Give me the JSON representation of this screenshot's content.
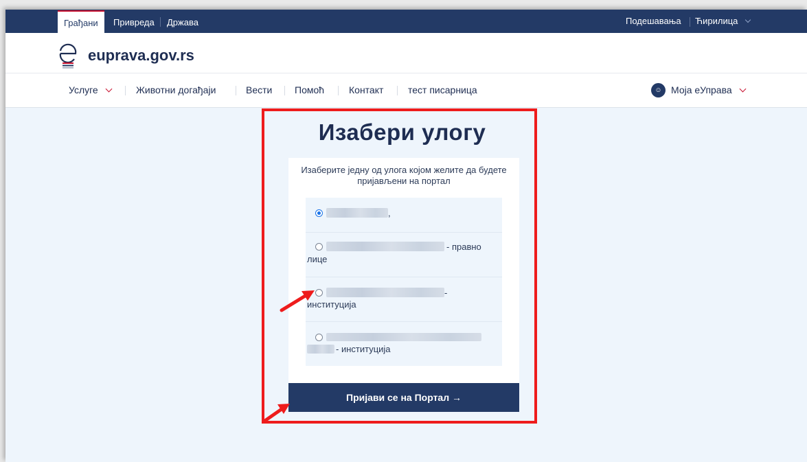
{
  "topbar": {
    "tabs": [
      {
        "label": "Грађани",
        "active": true
      },
      {
        "label": "Привреда",
        "active": false
      },
      {
        "label": "Држава",
        "active": false
      }
    ],
    "settings_label": "Подешавања",
    "language_label": "Ћирилица"
  },
  "header": {
    "logo_text": "euprava.gov.rs"
  },
  "nav": {
    "items": [
      {
        "label": "Услуге"
      },
      {
        "label": "Животни догађаји"
      },
      {
        "label": "Вести"
      },
      {
        "label": "Помоћ"
      },
      {
        "label": "Контакт"
      },
      {
        "label": "тест писарница"
      }
    ],
    "account_label": "Моја еУправа"
  },
  "main": {
    "title": "Изабери улогу",
    "instruction": "Изаберите једну од улога којом желите да будете пријављени на портал",
    "roles": [
      {
        "suffix": ",",
        "selected": true
      },
      {
        "suffix": "- правно лице",
        "line1_suffix": "- правно",
        "line2": "лице",
        "selected": false
      },
      {
        "suffix": "- институција",
        "line1_suffix": "-",
        "line2": "институција",
        "selected": false
      },
      {
        "suffix": "- институција",
        "line2": "- институција",
        "selected": false
      }
    ],
    "login_button": "Пријави се на Портал →"
  },
  "colors": {
    "primary": "#233a66",
    "accent_red": "#c8102e",
    "annotation_red": "#ee1c1c",
    "page_bg": "#eef5fc"
  }
}
